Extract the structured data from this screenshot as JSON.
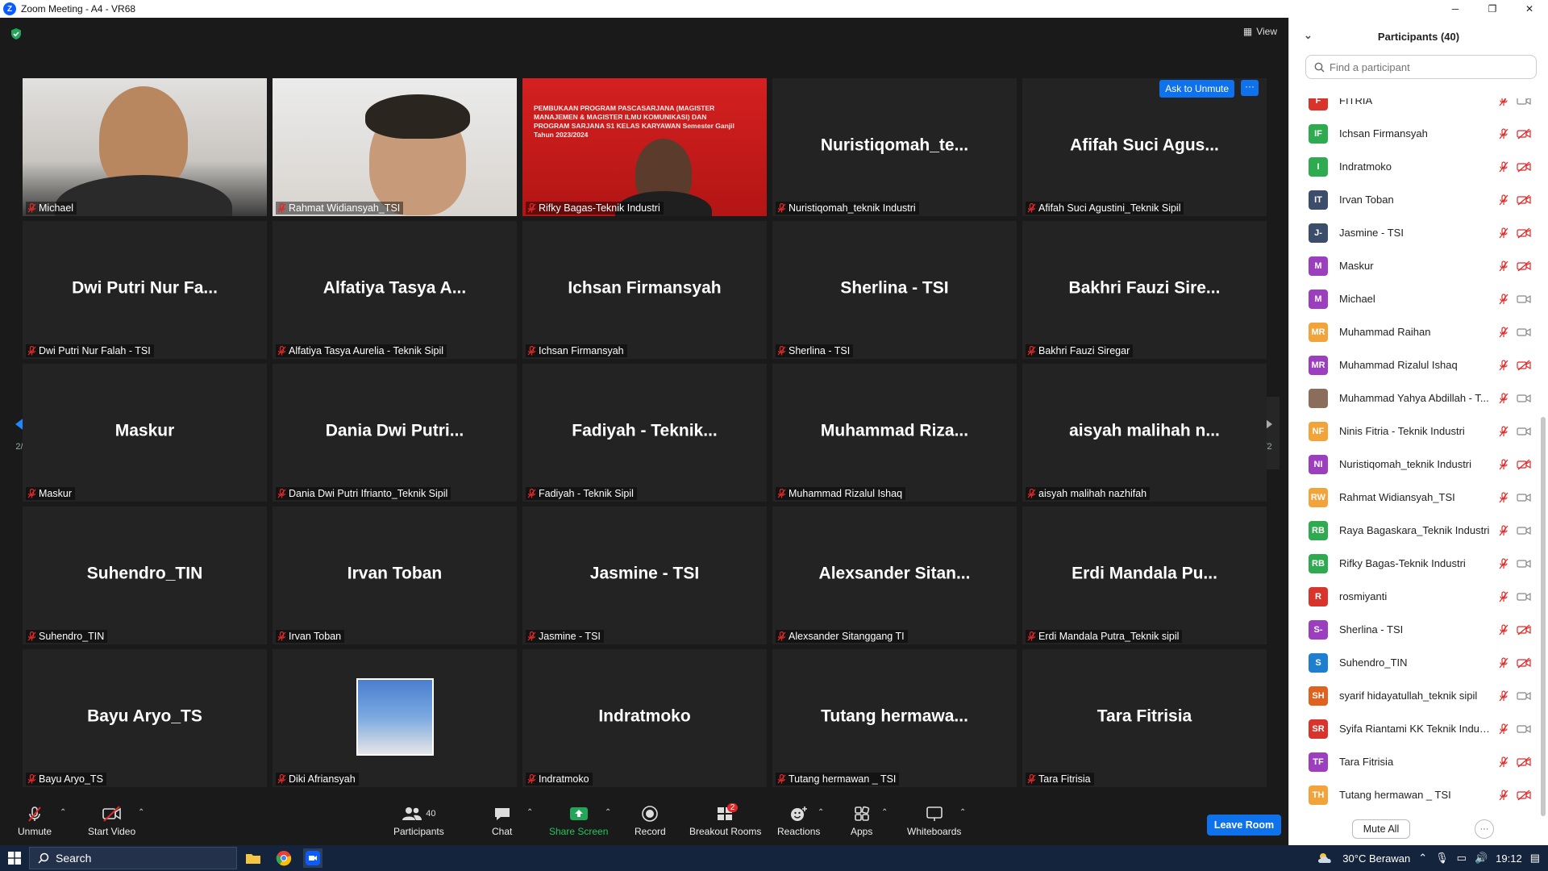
{
  "window": {
    "title": "Zoom Meeting - A4 - VR68",
    "minimize": "─",
    "maximize": "❐",
    "close": "✕"
  },
  "view_label": "View",
  "page_indicator": "2/2",
  "ask_to_unmute": "Ask to Unmute",
  "tile_more": "···",
  "slide_text": "PEMBUKAAN PROGRAM PASCASARJANA (MAGISTER MANAJEMEN & MAGISTER ILMU KOMUNIKASI) DAN PROGRAM SARJANA S1 KELAS KARYAWAN Semester Ganjil Tahun 2023/2024",
  "tiles": [
    {
      "big": "",
      "name": "Michael"
    },
    {
      "big": "",
      "name": "Rahmat Widiansyah_TSI"
    },
    {
      "big": "",
      "name": "Rifky Bagas-Teknik Industri"
    },
    {
      "big": "Nuristiqomah_te...",
      "name": "Nuristiqomah_teknik Industri"
    },
    {
      "big": "Afifah Suci Agus...",
      "name": "Afifah Suci Agustini_Teknik Sipil"
    },
    {
      "big": "Dwi Putri Nur Fa...",
      "name": "Dwi Putri Nur Falah - TSI"
    },
    {
      "big": "Alfatiya Tasya A...",
      "name": "Alfatiya Tasya Aurelia - Teknik Sipil"
    },
    {
      "big": "Ichsan Firmansyah",
      "name": "Ichsan Firmansyah"
    },
    {
      "big": "Sherlina - TSI",
      "name": "Sherlina - TSI"
    },
    {
      "big": "Bakhri Fauzi Sire...",
      "name": "Bakhri Fauzi Siregar"
    },
    {
      "big": "Maskur",
      "name": "Maskur"
    },
    {
      "big": "Dania Dwi Putri...",
      "name": "Dania Dwi Putri Ifrianto_Teknik Sipil"
    },
    {
      "big": "Fadiyah - Teknik...",
      "name": "Fadiyah - Teknik Sipil"
    },
    {
      "big": "Muhammad Riza...",
      "name": "Muhammad Rizalul Ishaq"
    },
    {
      "big": "aisyah malihah n...",
      "name": "aisyah malihah nazhifah"
    },
    {
      "big": "Suhendro_TIN",
      "name": "Suhendro_TIN"
    },
    {
      "big": "Irvan Toban",
      "name": "Irvan Toban"
    },
    {
      "big": "Jasmine - TSI",
      "name": "Jasmine - TSI"
    },
    {
      "big": "Alexsander Sitan...",
      "name": "Alexsander Sitanggang TI"
    },
    {
      "big": "Erdi Mandala Pu...",
      "name": "Erdi Mandala Putra_Teknik sipil"
    },
    {
      "big": "Bayu Aryo_TS",
      "name": "Bayu Aryo_TS"
    },
    {
      "big": "",
      "name": "Diki Afriansyah"
    },
    {
      "big": "Indratmoko",
      "name": "Indratmoko"
    },
    {
      "big": "Tutang hermawa...",
      "name": "Tutang hermawan _ TSI"
    },
    {
      "big": "Tara Fitrisia",
      "name": "Tara Fitrisia"
    }
  ],
  "toolbar": {
    "unmute": "Unmute",
    "start_video": "Start Video",
    "participants": "Participants",
    "participants_count": "40",
    "chat": "Chat",
    "share_screen": "Share Screen",
    "record": "Record",
    "breakout_rooms": "Breakout Rooms",
    "breakout_badge": "2",
    "reactions": "Reactions",
    "apps": "Apps",
    "whiteboards": "Whiteboards",
    "leave_room": "Leave Room"
  },
  "panel": {
    "title": "Participants (40)",
    "search_placeholder": "Find a participant",
    "mute_all": "Mute All",
    "more": "···",
    "participants": [
      {
        "initials": "F",
        "name": "FITRIA",
        "color": "#d9342b",
        "cam_off": false
      },
      {
        "initials": "IF",
        "name": "Ichsan Firmansyah",
        "color": "#2eab4f",
        "cam_off": true
      },
      {
        "initials": "I",
        "name": "Indratmoko",
        "color": "#2eab4f",
        "cam_off": true
      },
      {
        "initials": "IT",
        "name": "Irvan Toban",
        "color": "#3c4d6b",
        "cam_off": true
      },
      {
        "initials": "J-",
        "name": "Jasmine - TSI",
        "color": "#3c4d6b",
        "cam_off": true
      },
      {
        "initials": "M",
        "name": "Maskur",
        "color": "#9b3fbf",
        "cam_off": true
      },
      {
        "initials": "M",
        "name": "Michael",
        "color": "#9b3fbf",
        "cam_off": false
      },
      {
        "initials": "MR",
        "name": "Muhammad Raihan",
        "color": "#f2a33a",
        "cam_off": false
      },
      {
        "initials": "MR",
        "name": "Muhammad Rizalul Ishaq",
        "color": "#9b3fbf",
        "cam_off": true
      },
      {
        "initials": "",
        "name": "Muhammad Yahya Abdillah - T...",
        "color": "#8a6d5a",
        "cam_off": false
      },
      {
        "initials": "NF",
        "name": "Ninis Fitria - Teknik Industri",
        "color": "#f2a33a",
        "cam_off": false
      },
      {
        "initials": "NI",
        "name": "Nuristiqomah_teknik Industri",
        "color": "#9b3fbf",
        "cam_off": true
      },
      {
        "initials": "RW",
        "name": "Rahmat Widiansyah_TSI",
        "color": "#f2a33a",
        "cam_off": false
      },
      {
        "initials": "RB",
        "name": "Raya Bagaskara_Teknik Industri",
        "color": "#2eab4f",
        "cam_off": false
      },
      {
        "initials": "RB",
        "name": "Rifky Bagas-Teknik Industri",
        "color": "#2eab4f",
        "cam_off": false
      },
      {
        "initials": "R",
        "name": "rosmiyanti",
        "color": "#d9342b",
        "cam_off": false
      },
      {
        "initials": "S-",
        "name": "Sherlina - TSI",
        "color": "#9b3fbf",
        "cam_off": true
      },
      {
        "initials": "S",
        "name": "Suhendro_TIN",
        "color": "#1e7fd0",
        "cam_off": true
      },
      {
        "initials": "SH",
        "name": "syarif hidayatullah_teknik sipil",
        "color": "#e0621f",
        "cam_off": false
      },
      {
        "initials": "SR",
        "name": "Syifa Riantami KK Teknik Industri",
        "color": "#d9342b",
        "cam_off": false
      },
      {
        "initials": "TF",
        "name": "Tara Fitrisia",
        "color": "#9b3fbf",
        "cam_off": true
      },
      {
        "initials": "TH",
        "name": "Tutang hermawan _ TSI",
        "color": "#f2a33a",
        "cam_off": true
      }
    ]
  },
  "taskbar": {
    "search_label": "Search",
    "weather": "30°C  Berawan",
    "time": "19:12"
  }
}
